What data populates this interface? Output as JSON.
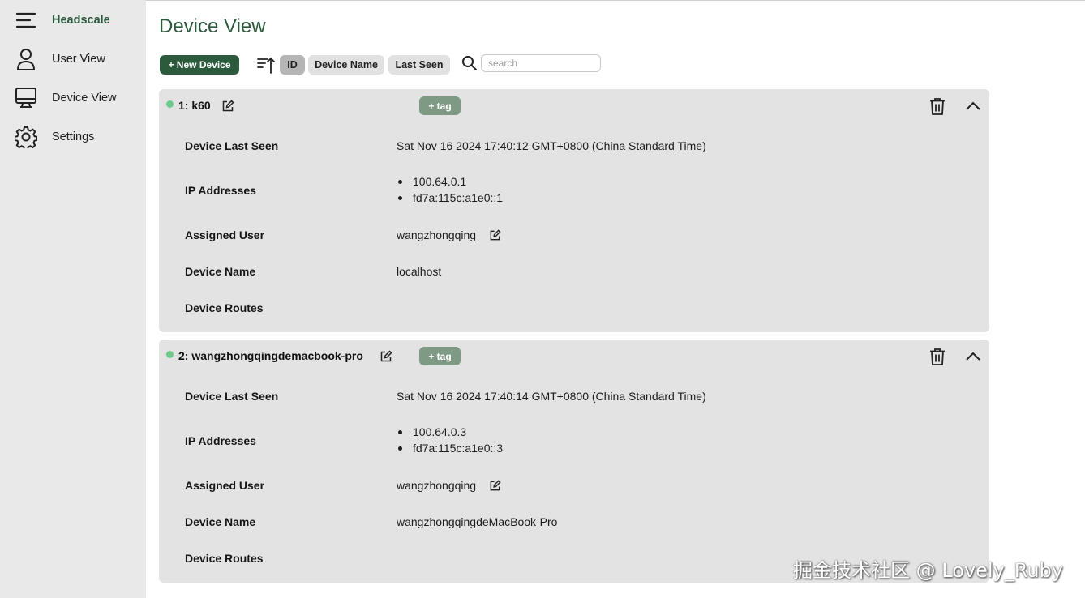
{
  "sidebar": {
    "brand": {
      "label": "Headscale",
      "icon": "menu-icon"
    },
    "items": [
      {
        "label": "User View",
        "icon": "user-icon"
      },
      {
        "label": "Device View",
        "icon": "monitor-icon"
      },
      {
        "label": "Settings",
        "icon": "gear-icon"
      }
    ]
  },
  "main": {
    "title": "Device View",
    "toolbar": {
      "new_device_label": "+ New Device",
      "sort_chips": [
        "ID",
        "Device Name",
        "Last Seen"
      ],
      "active_sort": "ID",
      "search_placeholder": "search",
      "search_value": ""
    }
  },
  "devices": [
    {
      "title": "1: k60",
      "online": true,
      "tag_label": "+ tag",
      "fields": {
        "last_seen_label": "Device Last Seen",
        "last_seen": "Sat Nov 16 2024 17:40:12 GMT+0800 (China Standard Time)",
        "ip_label": "IP Addresses",
        "ips": [
          "100.64.0.1",
          "fd7a:115c:a1e0::1"
        ],
        "user_label": "Assigned User",
        "user": "wangzhongqing",
        "name_label": "Device Name",
        "name": "localhost",
        "routes_label": "Device Routes"
      }
    },
    {
      "title": "2: wangzhongqingdemacbook-pro",
      "online": true,
      "tag_label": "+ tag",
      "fields": {
        "last_seen_label": "Device Last Seen",
        "last_seen": "Sat Nov 16 2024 17:40:14 GMT+0800 (China Standard Time)",
        "ip_label": "IP Addresses",
        "ips": [
          "100.64.0.3",
          "fd7a:115c:a1e0::3"
        ],
        "user_label": "Assigned User",
        "user": "wangzhongqing",
        "name_label": "Device Name",
        "name": "wangzhongqingdeMacBook-Pro",
        "routes_label": "Device Routes"
      }
    }
  ],
  "watermark": "掘金技术社区 @ Lovely_Ruby",
  "colors": {
    "accent": "#2b5a3d",
    "online": "#6ccb8b",
    "tag": "#7e9a85",
    "card": "#e3e3e3",
    "sidebar": "#e9e9e9"
  }
}
